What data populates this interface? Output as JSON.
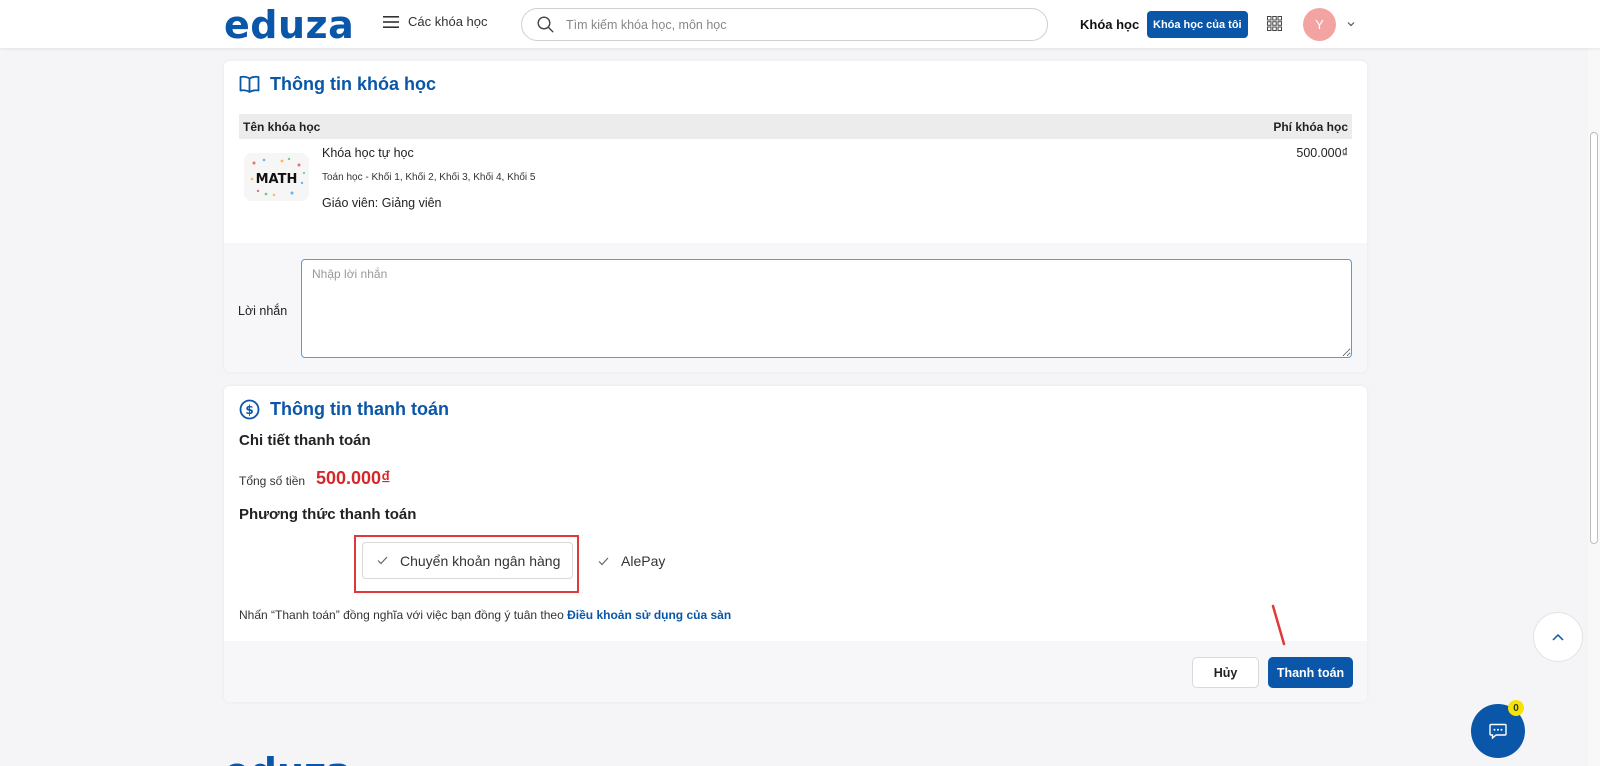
{
  "header": {
    "logo": "eduza",
    "menu_label": "Các khóa học",
    "search_placeholder": "Tìm kiếm khóa học, môn học",
    "nav_course": "Khóa học",
    "my_course_button": "Khóa học của tôi",
    "avatar_initial": "Y"
  },
  "course_info": {
    "title": "Thông tin khóa học",
    "col_name": "Tên khóa học",
    "col_fee": "Phí khóa học",
    "course": {
      "thumb_text": "MATH",
      "name": "Khóa học tự học",
      "tags": "Toán học - Khối 1, Khối 2, Khối 3, Khối 4, Khối 5",
      "teacher": "Giáo viên: Giảng viên",
      "price": "500.000₫"
    },
    "message_label": "Lời nhắn",
    "message_placeholder": "Nhập lời nhắn"
  },
  "payment": {
    "title": "Thông tin thanh toán",
    "detail_title": "Chi tiết thanh toán",
    "total_label": "Tổng số tiền",
    "total_value": "500.000₫",
    "method_title": "Phương thức thanh toán",
    "methods": [
      "Chuyển khoản ngân hàng",
      "AlePay"
    ],
    "terms_text": "Nhấn “Thanh toán” đồng nghĩa với việc bạn đồng ý tuân theo ",
    "terms_link": "Điều khoản sử dụng của sàn",
    "cancel_label": "Hủy",
    "pay_label": "Thanh toán"
  },
  "chat": {
    "badge_count": "0"
  },
  "footer": {
    "logo": "eduza"
  },
  "colors": {
    "brand": "#0a56a8",
    "price_red": "#d6282b",
    "highlight_red": "#e0393b"
  }
}
